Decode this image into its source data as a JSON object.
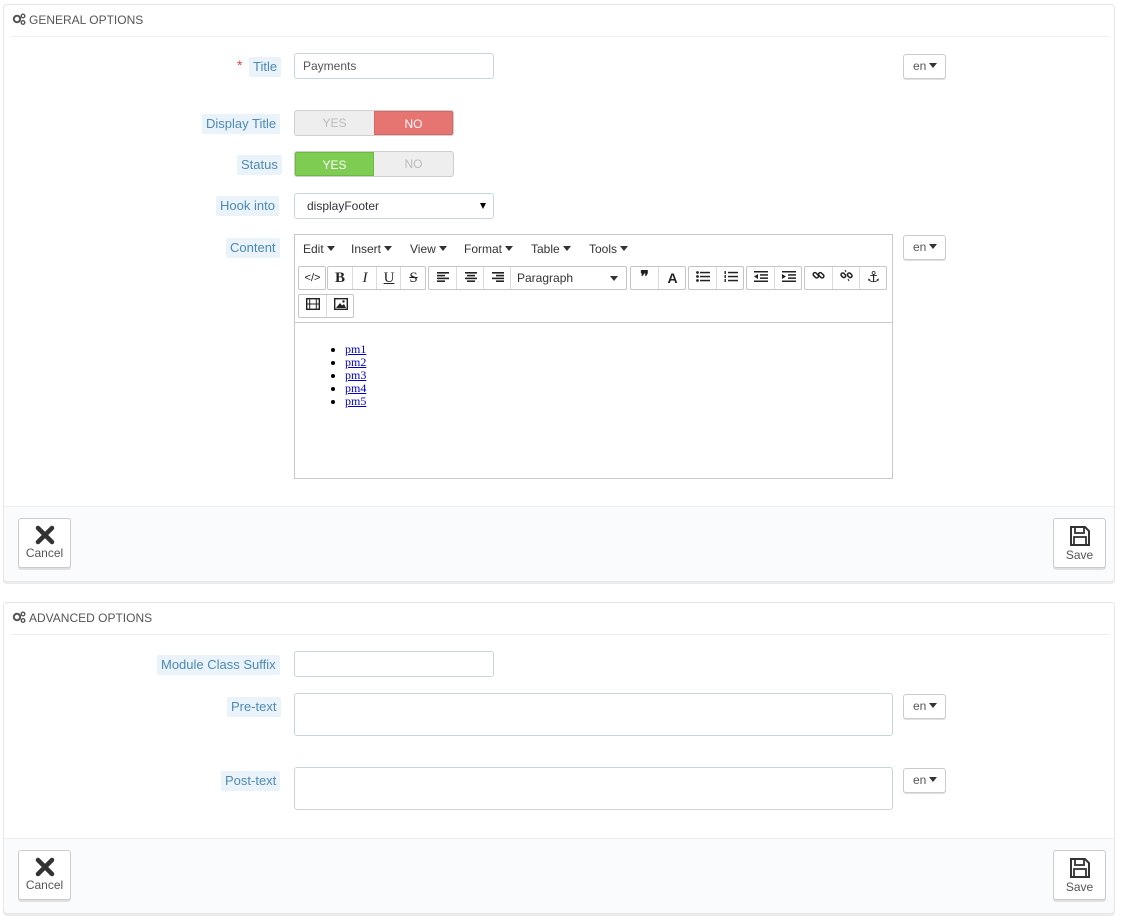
{
  "general": {
    "heading": "GENERAL OPTIONS",
    "title_label": "Title",
    "required_mark": "*",
    "title_value": "Payments",
    "lang": "en",
    "display_title_label": "Display Title",
    "display_title_yes": "YES",
    "display_title_no": "NO",
    "display_title_selected": "NO",
    "status_label": "Status",
    "status_yes": "YES",
    "status_no": "NO",
    "status_selected": "YES",
    "hook_label": "Hook into",
    "hook_value": "displayFooter",
    "content_label": "Content",
    "content_lang": "en",
    "editor": {
      "menus": [
        "Edit",
        "Insert",
        "View",
        "Format",
        "Table",
        "Tools"
      ],
      "format_select": "Paragraph",
      "list_items": [
        "pm1",
        "pm2",
        "pm3",
        "pm4",
        "pm5"
      ]
    },
    "cancel_label": "Cancel",
    "save_label": "Save"
  },
  "advanced": {
    "heading": "ADVANCED OPTIONS",
    "suffix_label": "Module Class Suffix",
    "suffix_value": "",
    "pretext_label": "Pre-text",
    "pretext_lang": "en",
    "posttext_label": "Post-text",
    "posttext_lang": "en",
    "cancel_label": "Cancel",
    "save_label": "Save"
  },
  "colors": {
    "label_bg": "#eaf3f9",
    "label_text": "#4c89b5",
    "switch_no_active": "#e67470",
    "switch_yes_active": "#7ecc52",
    "required": "#e34242"
  },
  "icons": [
    "cogs-icon",
    "close-icon",
    "save-icon",
    "source-code-icon",
    "bold-icon",
    "italic-icon",
    "underline-icon",
    "strikethrough-icon",
    "align-left-icon",
    "align-center-icon",
    "align-right-icon",
    "blockquote-icon",
    "text-color-icon",
    "bullet-list-icon",
    "numbered-list-icon",
    "outdent-icon",
    "indent-icon",
    "link-icon",
    "unlink-icon",
    "anchor-icon",
    "media-icon",
    "image-icon"
  ]
}
